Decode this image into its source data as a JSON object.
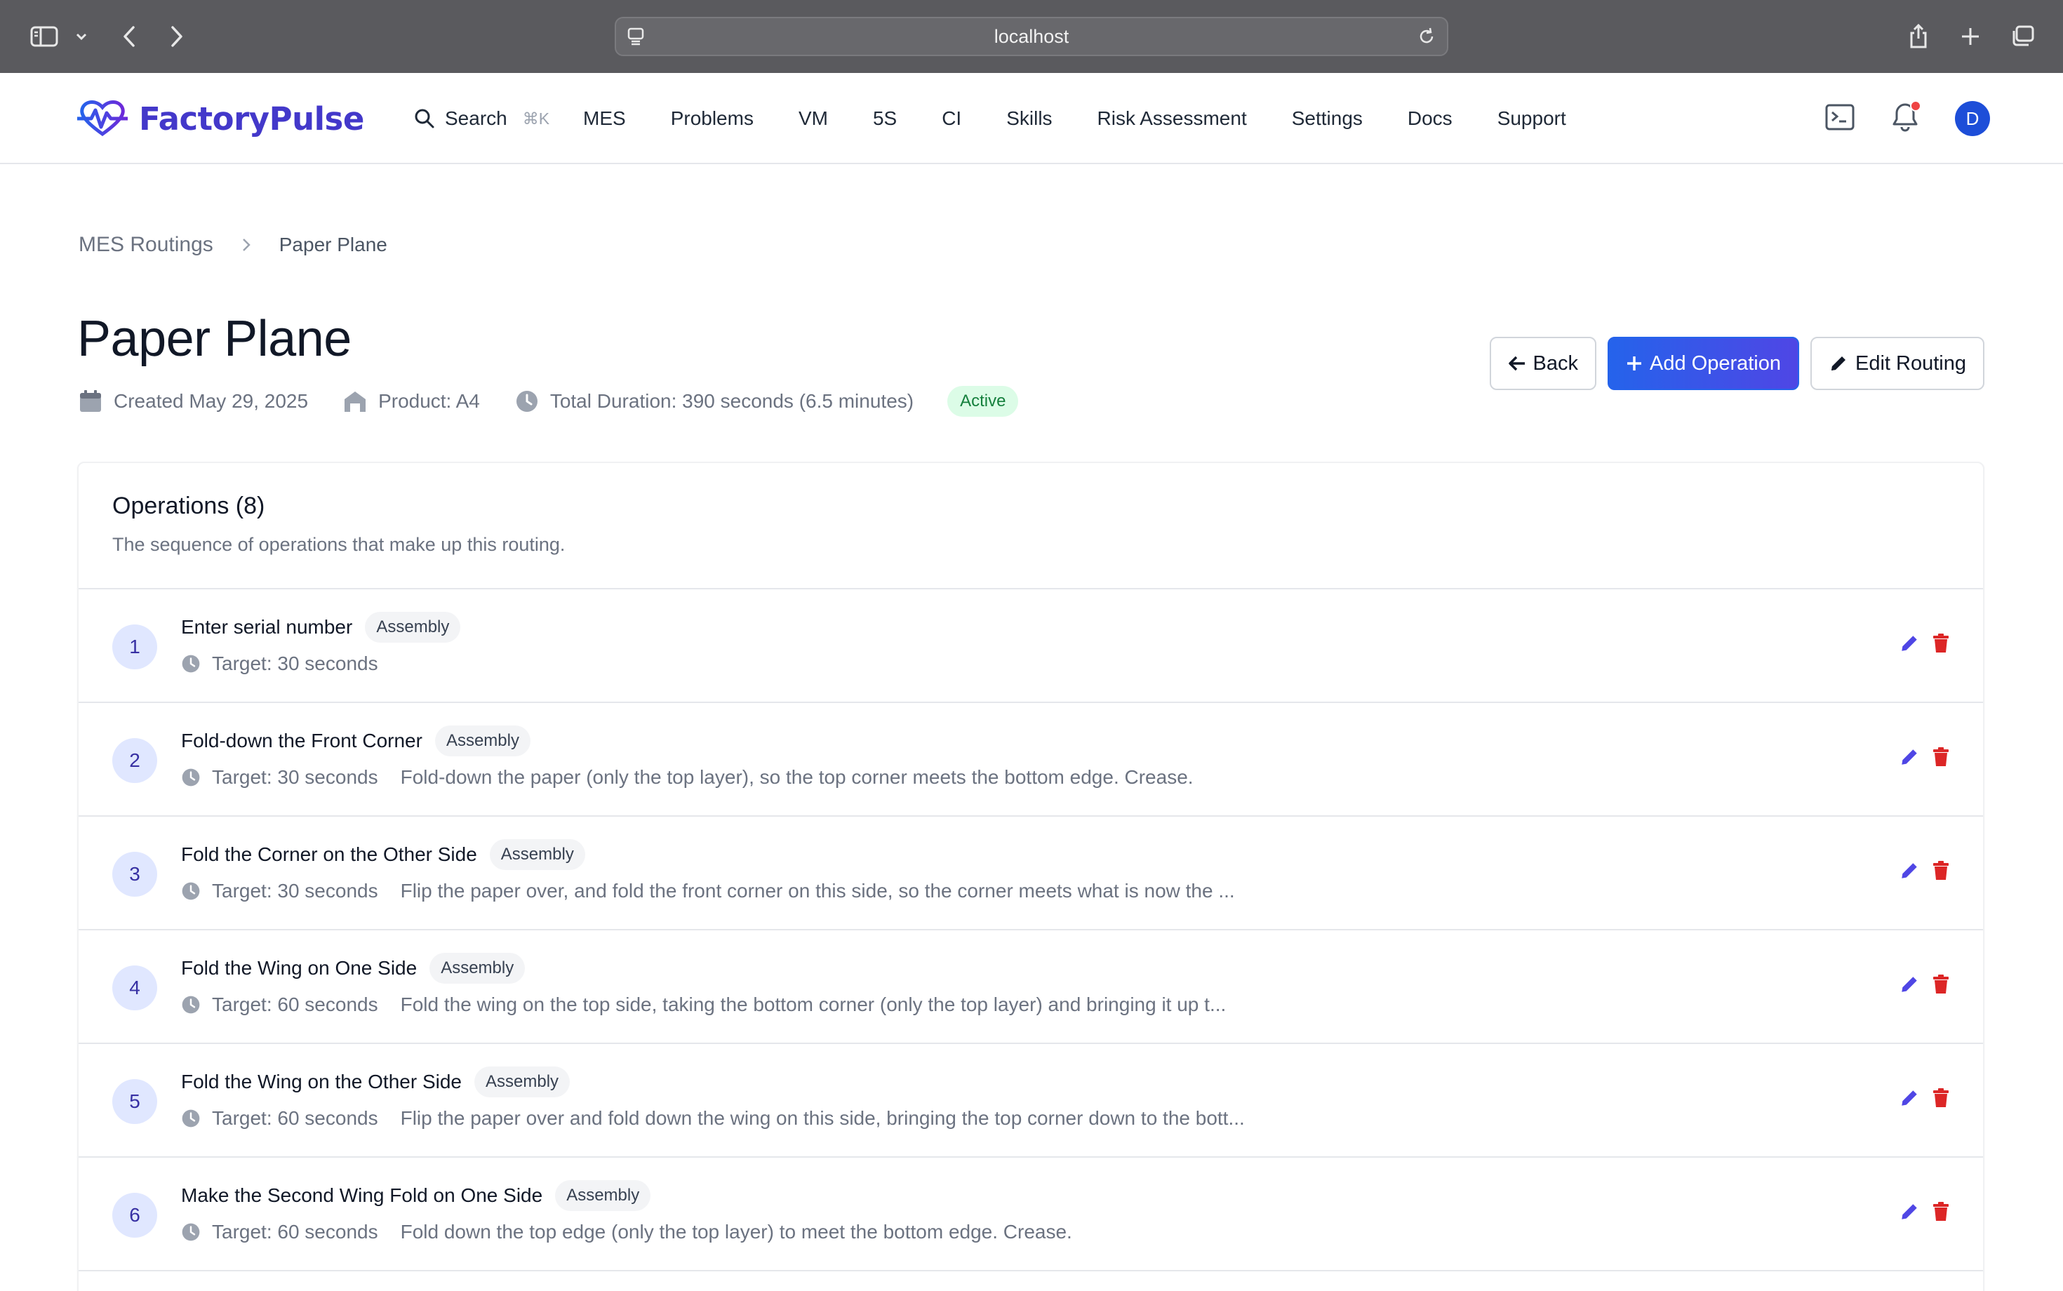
{
  "browser": {
    "url": "localhost"
  },
  "app": {
    "brand": "FactoryPulse",
    "search_label": "Search",
    "search_shortcut": "⌘K",
    "nav": [
      "MES",
      "Problems",
      "VM",
      "5S",
      "CI",
      "Skills",
      "Risk Assessment",
      "Settings",
      "Docs",
      "Support"
    ],
    "avatar_initial": "D"
  },
  "breadcrumb": {
    "parent": "MES Routings",
    "current": "Paper Plane"
  },
  "page": {
    "title": "Paper Plane",
    "created": "Created May 29, 2025",
    "product": "Product: A4",
    "duration": "Total Duration: 390 seconds (6.5 minutes)",
    "status": "Active"
  },
  "actions": {
    "back": "Back",
    "add_operation": "Add Operation",
    "edit_routing": "Edit Routing"
  },
  "operations": {
    "title": "Operations (8)",
    "subtitle": "The sequence of operations that make up this routing.",
    "items": [
      {
        "num": "1",
        "name": "Enter serial number",
        "tag": "Assembly",
        "target": "Target: 30 seconds",
        "desc": ""
      },
      {
        "num": "2",
        "name": "Fold-down the Front Corner",
        "tag": "Assembly",
        "target": "Target: 30 seconds",
        "desc": "Fold-down the paper (only the top layer), so the top corner meets the bottom edge. Crease."
      },
      {
        "num": "3",
        "name": "Fold the Corner on the Other Side",
        "tag": "Assembly",
        "target": "Target: 30 seconds",
        "desc": "Flip the paper over, and fold the front corner on this side, so the corner meets what is now the ..."
      },
      {
        "num": "4",
        "name": "Fold the Wing on One Side",
        "tag": "Assembly",
        "target": "Target: 60 seconds",
        "desc": "Fold the wing on the top side, taking the bottom corner (only the top layer) and bringing it up t..."
      },
      {
        "num": "5",
        "name": "Fold the Wing on the Other Side",
        "tag": "Assembly",
        "target": "Target: 60 seconds",
        "desc": "Flip the paper over and fold down the wing on this side, bringing the top corner down to the bott..."
      },
      {
        "num": "6",
        "name": "Make the Second Wing Fold on One Side",
        "tag": "Assembly",
        "target": "Target: 60 seconds",
        "desc": "Fold down the top edge (only the top layer) to meet the bottom edge. Crease."
      }
    ]
  },
  "colors": {
    "brand": "#4338ca",
    "primary": "#2563eb",
    "edit": "#4f46e5",
    "delete": "#dc2626",
    "active_bg": "#dcfce7",
    "active_text": "#15803d"
  }
}
